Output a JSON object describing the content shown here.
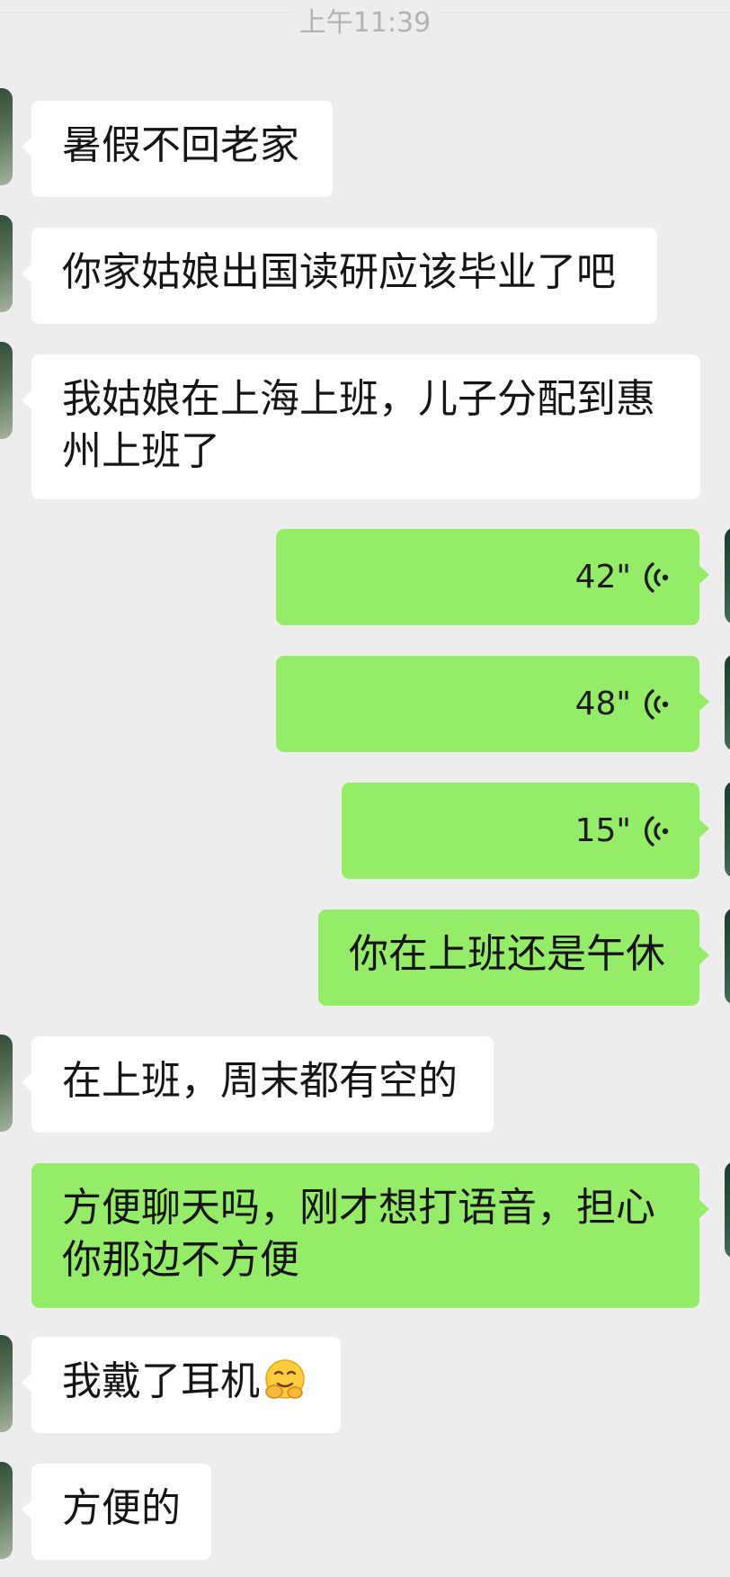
{
  "chat": {
    "timestamp": "上午11:39",
    "messages": [
      {
        "side": "in",
        "text": "暑假不回老家"
      },
      {
        "side": "in",
        "text": "你家姑娘出国读研应该毕业了吧"
      },
      {
        "side": "in",
        "text": "我姑娘在上海上班，儿子分配到惠州上班了"
      },
      {
        "side": "out",
        "type": "voice",
        "duration": "42\""
      },
      {
        "side": "out",
        "type": "voice",
        "duration": "48\""
      },
      {
        "side": "out",
        "type": "voice",
        "duration": "15\""
      },
      {
        "side": "out",
        "text": "你在上班还是午休"
      },
      {
        "side": "in",
        "text": "在上班，周末都有空的"
      },
      {
        "side": "out",
        "text": "方便聊天吗，刚才想打语音，担心你那边不方便"
      },
      {
        "side": "in",
        "text": "我戴了耳机",
        "emoji": "hugging-face-emoji"
      },
      {
        "side": "in",
        "text": "方便的"
      }
    ]
  },
  "colors": {
    "background": "#ededed",
    "incoming_bubble": "#ffffff",
    "outgoing_bubble": "#95ec69",
    "timestamp_text": "#b3b3b3"
  }
}
